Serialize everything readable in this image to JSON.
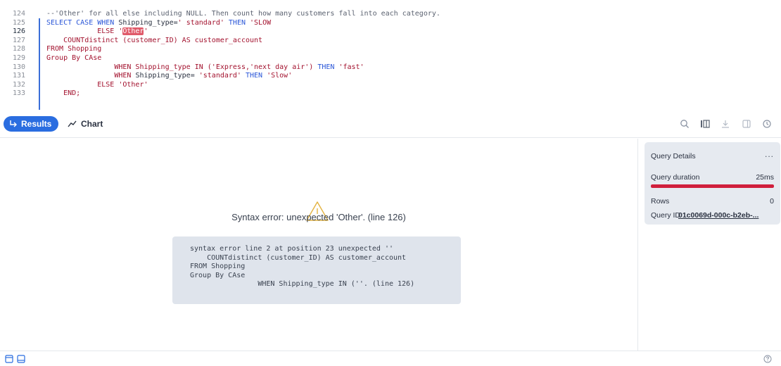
{
  "editor": {
    "lines": [
      {
        "num": "124",
        "parts": [
          [
            "cm",
            "--'Other' for all else including NULL. Then count how many customers fall into each category."
          ]
        ]
      },
      {
        "num": "125",
        "parts": [
          [
            "kw",
            "SELECT CASE WHEN "
          ],
          [
            "",
            "Shipping_type="
          ],
          [
            "str",
            "' standard'"
          ],
          [
            "kw",
            " THEN "
          ],
          [
            "str",
            "'SLOW"
          ]
        ]
      },
      {
        "num": "126",
        "current": true,
        "parts": [
          [
            "",
            "            "
          ],
          [
            "str",
            "ELSE '"
          ],
          [
            "err",
            "Other"
          ],
          [
            "str",
            "'"
          ]
        ]
      },
      {
        "num": "127",
        "parts": [
          [
            "",
            "    "
          ],
          [
            "str",
            "COUNTdistinct (customer_ID) AS customer_account"
          ]
        ]
      },
      {
        "num": "128",
        "parts": [
          [
            "str",
            "FROM Shopping"
          ]
        ]
      },
      {
        "num": "129",
        "parts": [
          [
            "str",
            "Group By CAse"
          ]
        ]
      },
      {
        "num": "130",
        "parts": [
          [
            "",
            "                "
          ],
          [
            "str",
            "WHEN Shipping_type IN ('Express,'next day air') "
          ],
          [
            "kw",
            "THEN "
          ],
          [
            "str",
            "'fast'"
          ]
        ]
      },
      {
        "num": "131",
        "parts": [
          [
            "",
            "                "
          ],
          [
            "str",
            "WHEN "
          ],
          [
            "",
            "Shipping_type= "
          ],
          [
            "str",
            "'standard'"
          ],
          [
            "kw",
            " THEN "
          ],
          [
            "str",
            "'Slow'"
          ]
        ]
      },
      {
        "num": "132",
        "parts": [
          [
            "",
            "            "
          ],
          [
            "str",
            "ELSE 'Other'"
          ]
        ]
      },
      {
        "num": "133",
        "parts": [
          [
            "",
            "    "
          ],
          [
            "str",
            "END;"
          ]
        ]
      }
    ]
  },
  "toolbar": {
    "results_label": "Results",
    "chart_label": "Chart",
    "icons": [
      "search-icon",
      "columns-icon",
      "download-icon",
      "panel-icon",
      "history-icon"
    ]
  },
  "result": {
    "error_title": "Syntax error: unexpected 'Other'. (line 126)",
    "error_detail": "syntax error line 2 at position 23 unexpected ''\n    COUNTdistinct (customer_ID) AS customer_account\nFROM Shopping\nGroup By CAse\n                WHEN Shipping_type IN (''. (line 126)"
  },
  "query_details": {
    "title": "Query Details",
    "more": "...",
    "duration_label": "Query duration",
    "duration_value": "25ms",
    "duration_fill_percent": 100,
    "rows_label": "Rows",
    "rows_value": "0",
    "id_label": "Query ID",
    "id_value": "01c0069d-000c-b2eb-..."
  },
  "colors": {
    "accent": "#2a6de0",
    "error_bar": "#d01f3c",
    "keyword": "#2a56d8",
    "string": "#a3122e"
  }
}
